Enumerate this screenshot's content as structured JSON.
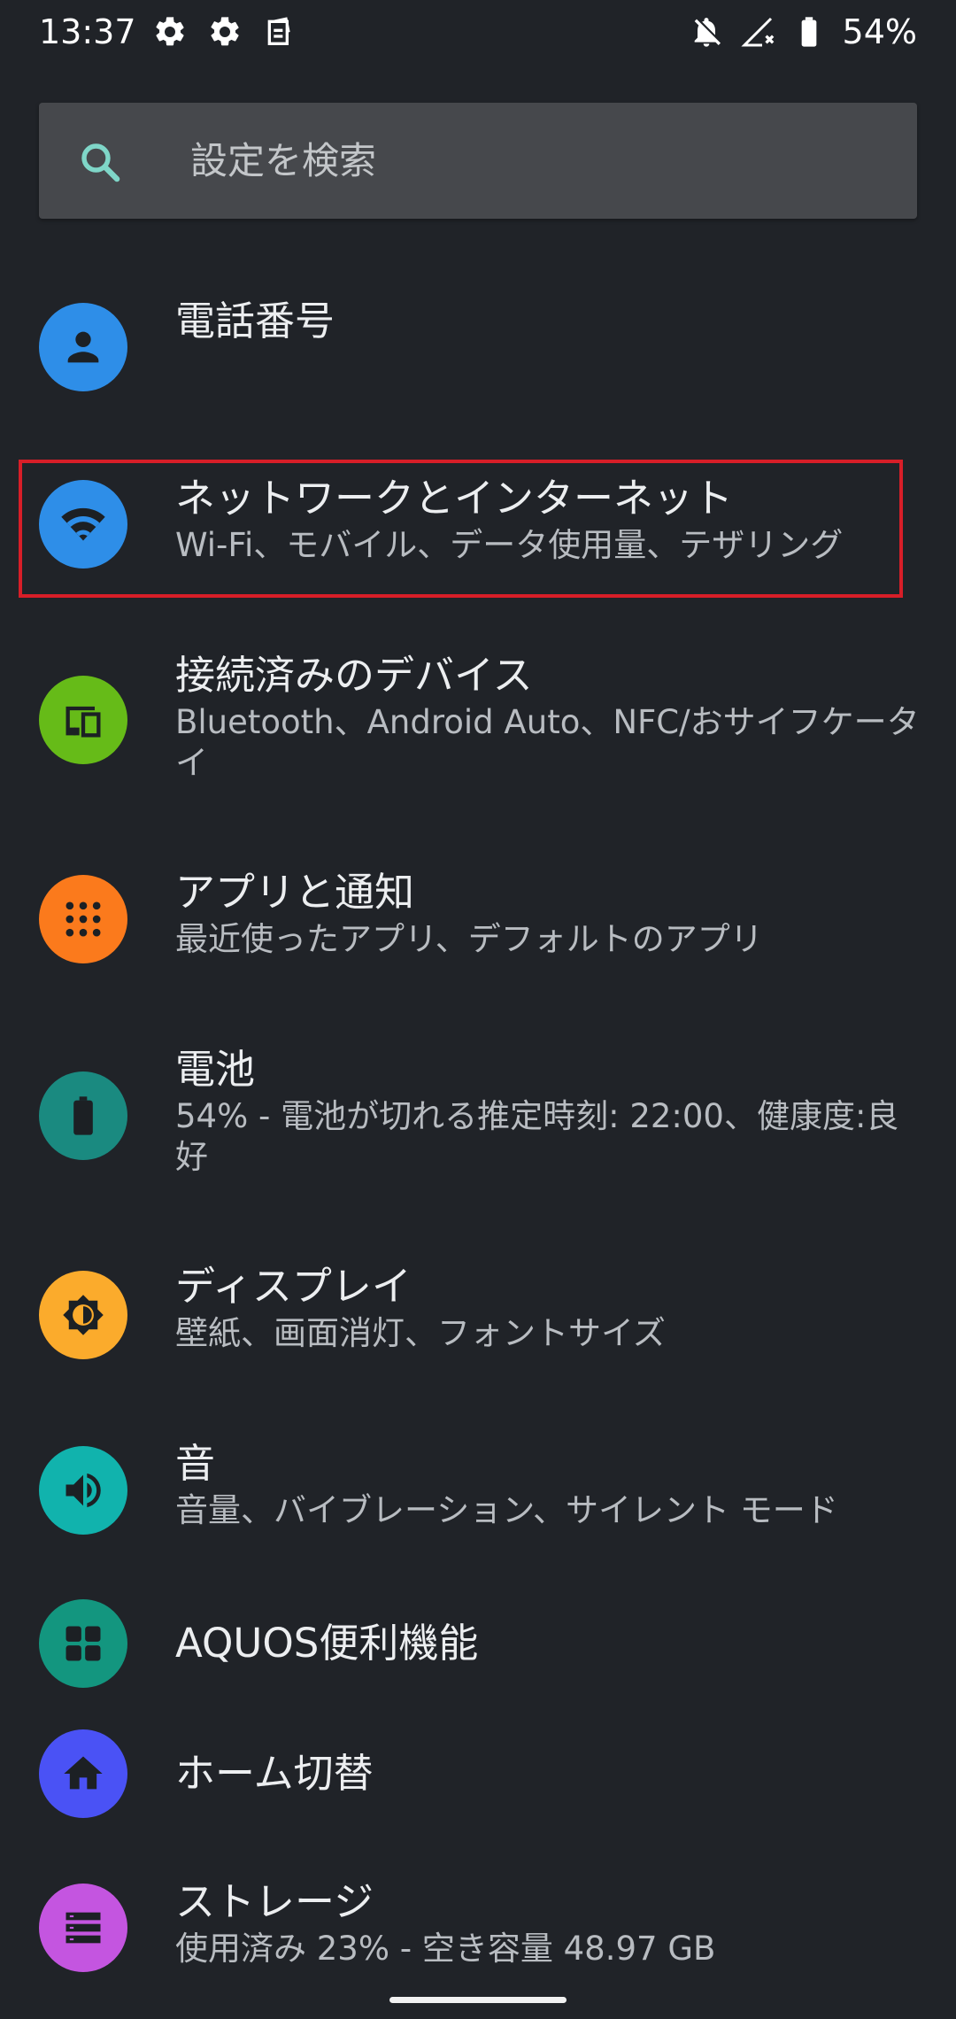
{
  "status_bar": {
    "time": "13:37",
    "battery_percent": "54%",
    "left_icons": [
      "gear-icon",
      "gear-icon",
      "clipboard-icon"
    ],
    "right_icons": [
      "bell-off-icon",
      "signal-off-icon",
      "battery-icon"
    ]
  },
  "search": {
    "placeholder": "設定を検索"
  },
  "settings": [
    {
      "id": "phone-number",
      "title": "電話番号",
      "subtitle": "",
      "icon": "person-icon",
      "color": "#2e8ee8"
    },
    {
      "id": "network-internet",
      "title": "ネットワークとインターネット",
      "subtitle": "Wi-Fi、モバイル、データ使用量、テザリング",
      "icon": "wifi-icon",
      "color": "#2e8ee8",
      "highlighted": true
    },
    {
      "id": "connected-devices",
      "title": "接続済みのデバイス",
      "subtitle": "Bluetooth、Android Auto、NFC/おサイフケータイ",
      "icon": "devices-icon",
      "color": "#66bb18"
    },
    {
      "id": "apps-notifications",
      "title": "アプリと通知",
      "subtitle": "最近使ったアプリ、デフォルトのアプリ",
      "icon": "apps-grid-icon",
      "color": "#fb7a1c"
    },
    {
      "id": "battery",
      "title": "電池",
      "subtitle": "54% - 電池が切れる推定時刻: 22:00、健康度:良好",
      "icon": "battery-icon",
      "color": "#1a8a80"
    },
    {
      "id": "display",
      "title": "ディスプレイ",
      "subtitle": "壁紙、画面消灯、フォントサイズ",
      "icon": "brightness-icon",
      "color": "#fbab2c"
    },
    {
      "id": "sound",
      "title": "音",
      "subtitle": "音量、バイブレーション、サイレント モード",
      "icon": "volume-icon",
      "color": "#11b3ad"
    },
    {
      "id": "aquos-features",
      "title": "AQUOS便利機能",
      "subtitle": "",
      "icon": "tiles-icon",
      "color": "#13967f"
    },
    {
      "id": "home-switch",
      "title": "ホーム切替",
      "subtitle": "",
      "icon": "home-icon",
      "color": "#4a52f5"
    },
    {
      "id": "storage",
      "title": "ストレージ",
      "subtitle": "使用済み 23% - 空き容量 48.97 GB",
      "icon": "storage-icon",
      "color": "#c455e0"
    }
  ],
  "colors": {
    "background": "#202328",
    "search_bar": "#46484c",
    "highlight_border": "#d71e28",
    "search_icon": "#7fd6c8"
  }
}
